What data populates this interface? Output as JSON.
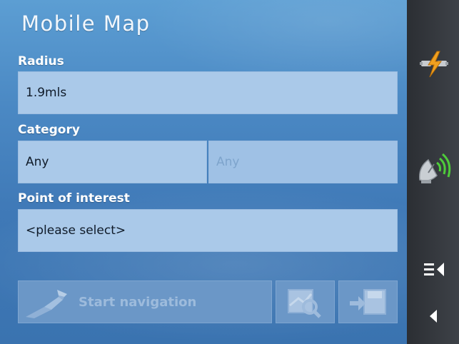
{
  "window": {
    "title": "Mobile Map"
  },
  "form": {
    "radius": {
      "label": "Radius",
      "value": "1.9mls"
    },
    "category": {
      "label": "Category",
      "value": "Any",
      "subcategory_value": "Any"
    },
    "poi": {
      "label": "Point of interest",
      "value": "<please select>"
    }
  },
  "actions": {
    "start_navigation": "Start navigation",
    "show_on_map_icon": "map-search-icon",
    "save_icon": "save-destination-icon"
  },
  "sidebar": {
    "icons": [
      "power-icon",
      "gps-satellite-icon",
      "menu-icon",
      "back-icon"
    ]
  },
  "colors": {
    "background": "#4b89c4",
    "field": "#aac9e9",
    "sidebar": "#34373c",
    "accent_orange": "#f0a020",
    "gps_green": "#4ecb3a"
  }
}
